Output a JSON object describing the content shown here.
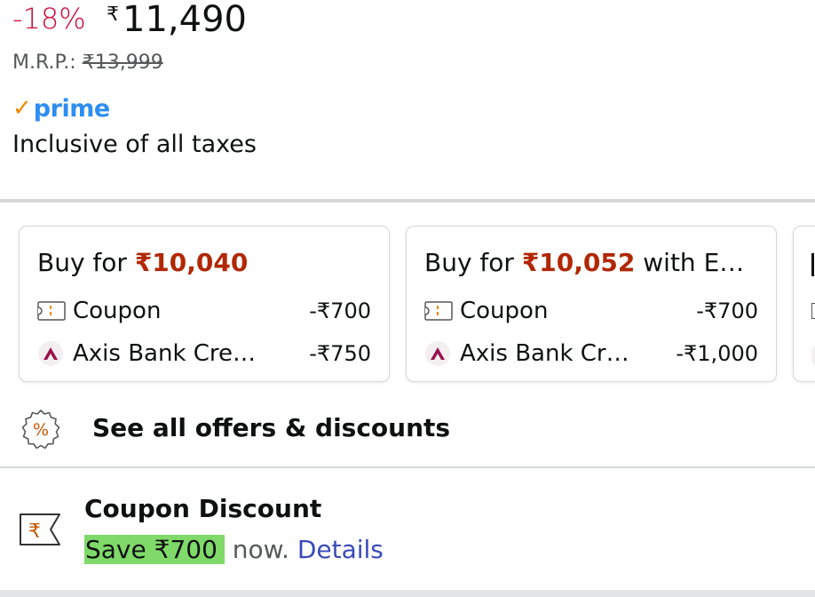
{
  "price": {
    "discount": "-18%",
    "currency_symbol": "₹",
    "amount": "11,490",
    "mrp_label": "M.R.P.:",
    "mrp_value": "₹13,999",
    "prime_check": "✓",
    "prime_word": "prime",
    "taxes_note": "Inclusive of all taxes"
  },
  "offers": [
    {
      "title_prefix": "Buy for ",
      "title_amount": "₹10,040",
      "title_suffix": "",
      "rows": [
        {
          "icon": "coupon-icon",
          "label": "Coupon",
          "value": "-₹700"
        },
        {
          "icon": "axis-bank-icon",
          "label": "Axis Bank Cre…",
          "value": "-₹750"
        }
      ]
    },
    {
      "title_prefix": "Buy for ",
      "title_amount": "₹10,052",
      "title_suffix": " with E…",
      "rows": [
        {
          "icon": "coupon-icon",
          "label": "Coupon",
          "value": "-₹700"
        },
        {
          "icon": "axis-bank-icon",
          "label": "Axis Bank Cr…",
          "value": "-₹1,000"
        }
      ]
    }
  ],
  "see_all": {
    "icon": "percent-badge-icon",
    "label": "See all offers & discounts"
  },
  "coupon": {
    "icon": "rupee-coupon-icon",
    "title": "Coupon Discount",
    "save_text": "Save ₹700",
    "now_text": " now.",
    "details_link": "Details"
  },
  "colors": {
    "discount": "#cc0c39",
    "offer_amount": "#b12704",
    "prime_blue": "#2d8ef1",
    "prime_check": "#f08804",
    "link": "#3a4ab8",
    "coupon_highlight": "#7fda69"
  }
}
